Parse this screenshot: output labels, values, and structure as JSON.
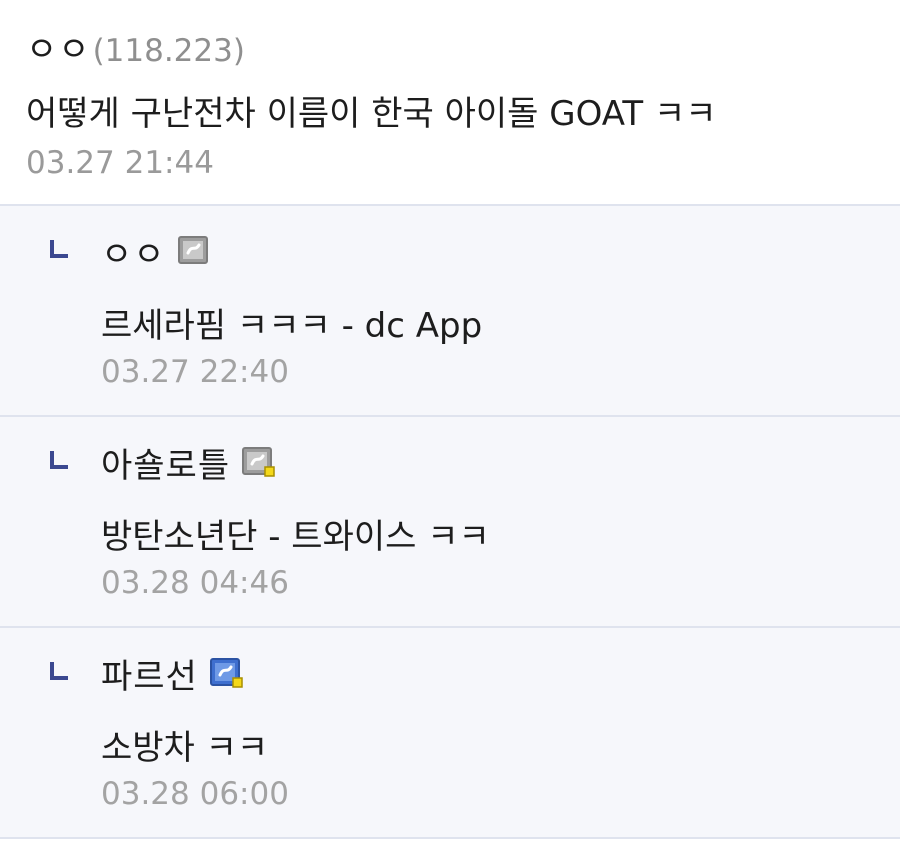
{
  "comment": {
    "nickname": "ㅇㅇ",
    "ip": "(118.223)",
    "text": "어떻게 구난전차 이름이 한국 아이돌 GOAT ㅋㅋ",
    "date": "03.27 21:44"
  },
  "replies": [
    {
      "nickname": "ㅇㅇ",
      "icon": "gallog-gray-icon",
      "text": "르세라핌 ㅋㅋㅋ - dc App",
      "date": "03.27 22:40"
    },
    {
      "nickname": "아숄로틀",
      "icon": "gallog-gray-fixed-icon",
      "text": "방탄소년단 - 트와이스 ㅋㅋ",
      "date": "03.28 04:46"
    },
    {
      "nickname": "파르선",
      "icon": "gallog-blue-fixed-icon",
      "text": "소방차 ㅋㅋ",
      "date": "03.28 06:00"
    }
  ],
  "colors": {
    "reply_bg": "#f6f7fb",
    "divider": "#dfe3ee",
    "reply_arrow": "#3b4890",
    "meta_text": "#9a9a9a",
    "icon_gray": "#9d9d9d",
    "icon_blue": "#3e6fcf",
    "icon_badge": "#f4d81a"
  }
}
